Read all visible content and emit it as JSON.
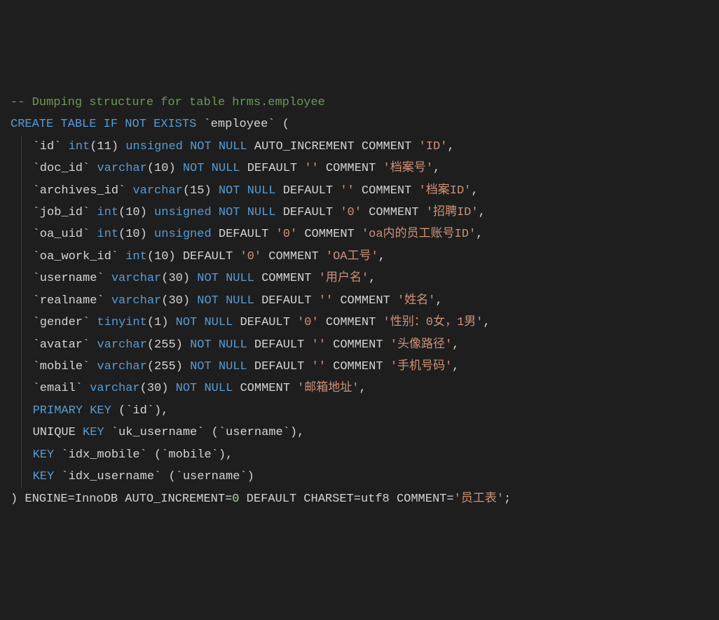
{
  "comment_line": "-- Dumping structure for table hrms.employee",
  "create_stmt": {
    "create": "CREATE",
    "table": "TABLE",
    "if": "IF",
    "not": "NOT",
    "exists": "EXISTS",
    "tablename": "`employee`",
    "open": "("
  },
  "columns": [
    {
      "name": "`id`",
      "type": "int",
      "size": "(11)",
      "attrs": [
        {
          "t": "k",
          "v": "unsigned"
        },
        {
          "t": "k",
          "v": "NOT"
        },
        {
          "t": "k",
          "v": "NULL"
        },
        {
          "t": "p",
          "v": "AUTO_INCREMENT"
        },
        {
          "t": "p",
          "v": "COMMENT"
        },
        {
          "t": "s",
          "v": "'ID'"
        }
      ],
      "comma": ","
    },
    {
      "name": "`doc_id`",
      "type": "varchar",
      "size": "(10)",
      "attrs": [
        {
          "t": "k",
          "v": "NOT"
        },
        {
          "t": "k",
          "v": "NULL"
        },
        {
          "t": "p",
          "v": "DEFAULT"
        },
        {
          "t": "s",
          "v": "''"
        },
        {
          "t": "p",
          "v": "COMMENT"
        },
        {
          "t": "s",
          "v": "'档案号'"
        }
      ],
      "comma": ","
    },
    {
      "name": "`archives_id`",
      "type": "varchar",
      "size": "(15)",
      "attrs": [
        {
          "t": "k",
          "v": "NOT"
        },
        {
          "t": "k",
          "v": "NULL"
        },
        {
          "t": "p",
          "v": "DEFAULT"
        },
        {
          "t": "s",
          "v": "''"
        },
        {
          "t": "p",
          "v": "COMMENT"
        },
        {
          "t": "s",
          "v": "'档案ID'"
        }
      ],
      "comma": ","
    },
    {
      "name": "`job_id`",
      "type": "int",
      "size": "(10)",
      "attrs": [
        {
          "t": "k",
          "v": "unsigned"
        },
        {
          "t": "k",
          "v": "NOT"
        },
        {
          "t": "k",
          "v": "NULL"
        },
        {
          "t": "p",
          "v": "DEFAULT"
        },
        {
          "t": "s",
          "v": "'0'"
        },
        {
          "t": "p",
          "v": "COMMENT"
        },
        {
          "t": "s",
          "v": "'招聘ID'"
        }
      ],
      "comma": ","
    },
    {
      "name": "`oa_uid`",
      "type": "int",
      "size": "(10)",
      "attrs": [
        {
          "t": "k",
          "v": "unsigned"
        },
        {
          "t": "p",
          "v": "DEFAULT"
        },
        {
          "t": "s",
          "v": "'0'"
        },
        {
          "t": "p",
          "v": "COMMENT"
        },
        {
          "t": "s",
          "v": "'oa内的员工账号ID'"
        }
      ],
      "comma": ","
    },
    {
      "name": "`oa_work_id`",
      "type": "int",
      "size": "(10)",
      "attrs": [
        {
          "t": "p",
          "v": "DEFAULT"
        },
        {
          "t": "s",
          "v": "'0'"
        },
        {
          "t": "p",
          "v": "COMMENT"
        },
        {
          "t": "s",
          "v": "'OA工号'"
        }
      ],
      "comma": ","
    },
    {
      "name": "`username`",
      "type": "varchar",
      "size": "(30)",
      "attrs": [
        {
          "t": "k",
          "v": "NOT"
        },
        {
          "t": "k",
          "v": "NULL"
        },
        {
          "t": "p",
          "v": "COMMENT"
        },
        {
          "t": "s",
          "v": "'用户名'"
        }
      ],
      "comma": ","
    },
    {
      "name": "`realname`",
      "type": "varchar",
      "size": "(30)",
      "attrs": [
        {
          "t": "k",
          "v": "NOT"
        },
        {
          "t": "k",
          "v": "NULL"
        },
        {
          "t": "p",
          "v": "DEFAULT"
        },
        {
          "t": "s",
          "v": "''"
        },
        {
          "t": "p",
          "v": "COMMENT"
        },
        {
          "t": "s",
          "v": "'姓名'"
        }
      ],
      "comma": ","
    },
    {
      "name": "`gender`",
      "type": "tinyint",
      "size": "(1)",
      "attrs": [
        {
          "t": "k",
          "v": "NOT"
        },
        {
          "t": "k",
          "v": "NULL"
        },
        {
          "t": "p",
          "v": "DEFAULT"
        },
        {
          "t": "s",
          "v": "'0'"
        },
        {
          "t": "p",
          "v": "COMMENT"
        },
        {
          "t": "s",
          "v": "'性别：0女，1男'"
        }
      ],
      "comma": ","
    },
    {
      "name": "`avatar`",
      "type": "varchar",
      "size": "(255)",
      "attrs": [
        {
          "t": "k",
          "v": "NOT"
        },
        {
          "t": "k",
          "v": "NULL"
        },
        {
          "t": "p",
          "v": "DEFAULT"
        },
        {
          "t": "s",
          "v": "''"
        },
        {
          "t": "p",
          "v": "COMMENT"
        },
        {
          "t": "s",
          "v": "'头像路径'"
        }
      ],
      "comma": ","
    },
    {
      "name": "`mobile`",
      "type": "varchar",
      "size": "(255)",
      "attrs": [
        {
          "t": "k",
          "v": "NOT"
        },
        {
          "t": "k",
          "v": "NULL"
        },
        {
          "t": "p",
          "v": "DEFAULT"
        },
        {
          "t": "s",
          "v": "''"
        },
        {
          "t": "p",
          "v": "COMMENT"
        },
        {
          "t": "s",
          "v": "'手机号码'"
        }
      ],
      "comma": ","
    },
    {
      "name": "`email`",
      "type": "varchar",
      "size": "(30)",
      "attrs": [
        {
          "t": "k",
          "v": "NOT"
        },
        {
          "t": "k",
          "v": "NULL"
        },
        {
          "t": "p",
          "v": "COMMENT"
        },
        {
          "t": "s",
          "v": "'邮箱地址'"
        }
      ],
      "comma": ","
    }
  ],
  "keys": [
    {
      "tokens": [
        {
          "t": "k",
          "v": "PRIMARY"
        },
        {
          "t": "k",
          "v": "KEY"
        },
        {
          "t": "p",
          "v": "("
        },
        {
          "t": "i",
          "v": "`id`"
        },
        {
          "t": "p",
          "v": "),"
        }
      ]
    },
    {
      "tokens": [
        {
          "t": "p",
          "v": "UNIQUE"
        },
        {
          "t": "k",
          "v": "KEY"
        },
        {
          "t": "i",
          "v": "`uk_username`"
        },
        {
          "t": "p",
          "v": "("
        },
        {
          "t": "i",
          "v": "`username`"
        },
        {
          "t": "p",
          "v": "),"
        }
      ]
    },
    {
      "tokens": [
        {
          "t": "k",
          "v": "KEY"
        },
        {
          "t": "i",
          "v": "`idx_mobile`"
        },
        {
          "t": "p",
          "v": "("
        },
        {
          "t": "i",
          "v": "`mobile`"
        },
        {
          "t": "p",
          "v": "),"
        }
      ]
    },
    {
      "tokens": [
        {
          "t": "k",
          "v": "KEY"
        },
        {
          "t": "i",
          "v": "`idx_username`"
        },
        {
          "t": "p",
          "v": "("
        },
        {
          "t": "i",
          "v": "`username`"
        },
        {
          "t": "p",
          "v": ")"
        }
      ]
    }
  ],
  "footer": {
    "close": ")",
    "tokens": [
      {
        "t": "p",
        "v": "ENGINE="
      },
      {
        "t": "p",
        "v": "InnoDB"
      },
      {
        "t": "p",
        "v": " AUTO_INCREMENT="
      },
      {
        "t": "n",
        "v": "0"
      },
      {
        "t": "p",
        "v": " DEFAULT"
      },
      {
        "t": "p",
        "v": " CHARSET="
      },
      {
        "t": "p",
        "v": "utf8"
      },
      {
        "t": "p",
        "v": " COMMENT="
      },
      {
        "t": "s",
        "v": "'员工表'"
      },
      {
        "t": "p",
        "v": ";"
      }
    ]
  }
}
